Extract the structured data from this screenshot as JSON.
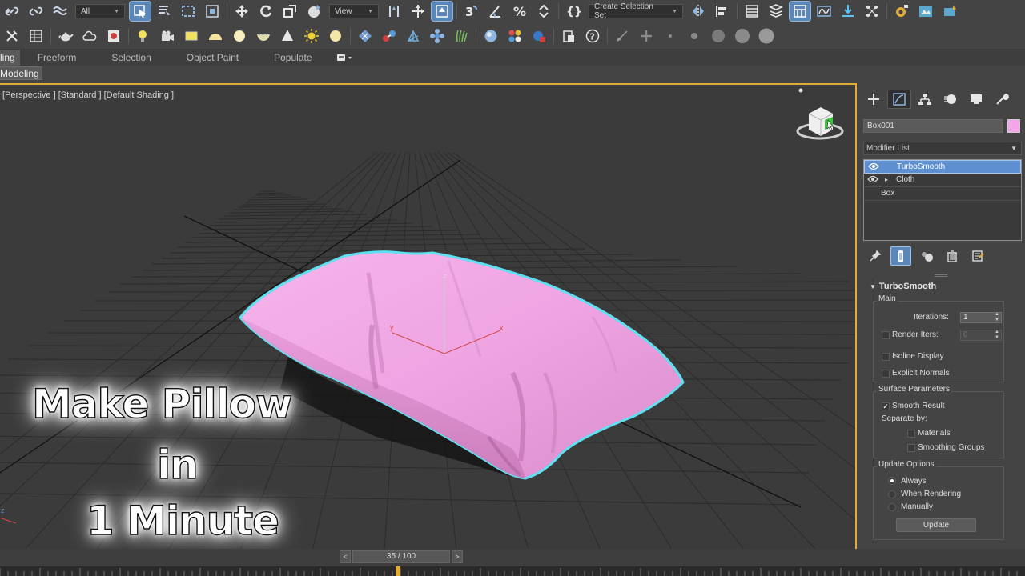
{
  "toolbar_main": {
    "selection_filter": "All",
    "reference_coord": "View",
    "create_selection_set": "Create Selection Set"
  },
  "ribbon": {
    "tabs": [
      {
        "label": "ling",
        "active": true
      },
      {
        "label": "Freeform",
        "active": false
      },
      {
        "label": "Selection",
        "active": false
      },
      {
        "label": "Object Paint",
        "active": false
      },
      {
        "label": "Populate",
        "active": false
      }
    ],
    "panel_label": "Modeling"
  },
  "viewport": {
    "label": "[Perspective ] [Standard ] [Default Shading ]",
    "gizmo_axes": {
      "z": "z",
      "x": "x",
      "y": "y"
    },
    "object_color": "#f3a6e6",
    "selection_outline_color": "#5fe0f0",
    "active_border_color": "#e0ac3a"
  },
  "overlay_title": {
    "line1": "Make Pillow",
    "line2": "in",
    "line3": "1 Minute"
  },
  "command_panel": {
    "object_name": "Box001",
    "object_color": "#f4a4e8",
    "modifier_list_label": "Modifier List",
    "stack": [
      {
        "name": "TurboSmooth",
        "selected": true,
        "visible_eye": true,
        "expandable": false
      },
      {
        "name": "Cloth",
        "selected": false,
        "visible_eye": true,
        "expandable": true
      },
      {
        "name": "Box",
        "selected": false,
        "visible_eye": false,
        "expandable": false
      }
    ],
    "rollout": {
      "title": "TurboSmooth",
      "main": {
        "title": "Main",
        "iterations_label": "Iterations:",
        "iterations_value": "1",
        "render_iters_label": "Render Iters:",
        "render_iters_value": "0",
        "render_iters_checked": false,
        "isoline_display_label": "Isoline Display",
        "isoline_display_checked": false,
        "explicit_normals_label": "Explicit Normals",
        "explicit_normals_checked": false
      },
      "surface": {
        "title": "Surface Parameters",
        "smooth_result_label": "Smooth Result",
        "smooth_result_checked": true,
        "separate_by_label": "Separate by:",
        "materials_label": "Materials",
        "materials_checked": false,
        "smoothing_groups_label": "Smoothing Groups",
        "smoothing_groups_checked": false
      },
      "update": {
        "title": "Update Options",
        "options": [
          "Always",
          "When Rendering",
          "Manually"
        ],
        "selected": "Always",
        "update_button": "Update"
      }
    }
  },
  "timeline": {
    "current_frame_label": "35 / 100",
    "prev": "<",
    "next": ">",
    "current_frame": 35,
    "total_frames": 100
  }
}
